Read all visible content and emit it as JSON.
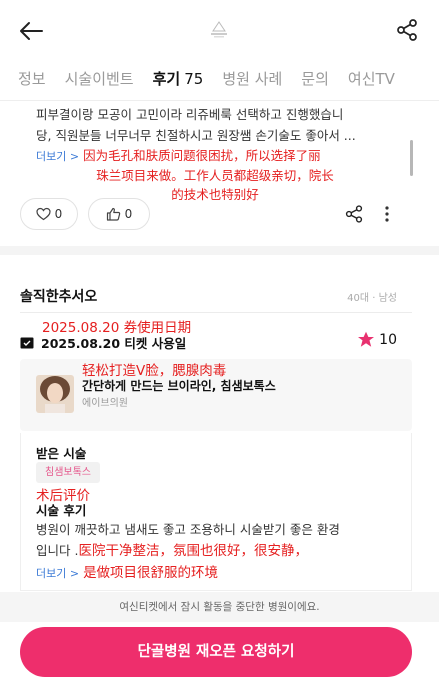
{
  "header": {
    "back_icon": "arrow-left-icon",
    "logo_icon": "clinic-logo-icon",
    "share_icon": "share-icon"
  },
  "tabs": [
    {
      "label": "정보"
    },
    {
      "label": "시술이벤트"
    },
    {
      "label": "후기",
      "count": "75",
      "active": true
    },
    {
      "label": "병원 사례"
    },
    {
      "label": "문의"
    },
    {
      "label": "여신TV"
    }
  ],
  "review_1": {
    "text_line1": "피부결이랑 모공이 고민이라 리쥬베룩 선택하고 진행했습니",
    "text_line2": "당, 직원분들 너무너무 친절하시고 원장쌤 손기술도 좋아서 ...",
    "more_label": "더보기 >",
    "translation_line1": "因为毛孔和肤质问题很困扰，所以选择了丽",
    "translation_line2": "珠兰项目来做。工作人员都超级亲切，院长",
    "translation_line3": "的技术也特别好",
    "likes": "0",
    "thumbs": "0"
  },
  "review_2": {
    "nickname": "솔직한추서오",
    "meta": "40대 · 남성",
    "date_translation": "2025.08.20 券使用日期",
    "date_label": "2025.08.20  티켓 사용일",
    "rating": "10",
    "product_translation": "轻松打造V脸，腮腺肉毒",
    "product_name": "간단하게 만드는 브이라인, 침샘보톡스",
    "clinic_name": "에이브의원",
    "received_label": "받은 시술",
    "procedure_chip": "침샘보톡스",
    "after_translation": "术后评价",
    "after_label": "시술 후기",
    "text_line1": "병원이 깨끗하고 냄새도 좋고 조용하니 시술받기 좋은 환경",
    "text_line2_kr": "입니다 .",
    "text_line2_cn": "医院干净整洁，氛围也很好，很安静，",
    "more_label": "더보기 >",
    "text_line3_cn": "是做项目很舒服的环境"
  },
  "notice": "여신티켓에서 잠시 활동을 중단한 병원이에요.",
  "cta_label": "단골병원 재오픈 요청하기",
  "colors": {
    "accent": "#ee2e6c",
    "annotation": "#e52020",
    "link": "#3d7bd6",
    "star": "#e8316f"
  }
}
